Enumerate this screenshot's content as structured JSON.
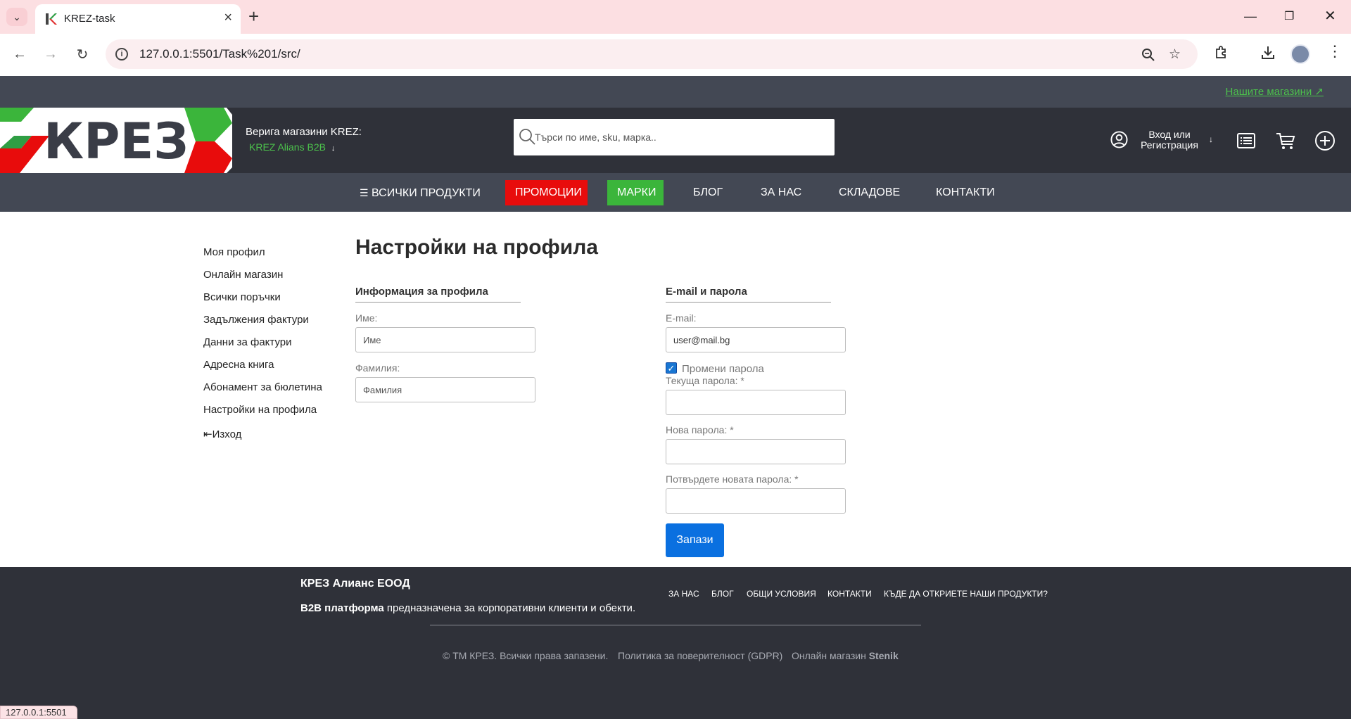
{
  "browser": {
    "tab_title": "KREZ-task",
    "url": "127.0.0.1:5501/Task%201/src/",
    "status_url": "127.0.0.1:5501"
  },
  "site": {
    "shops_link": "Нашите магазини",
    "chain_title": "Верига магазини KREZ:",
    "chain_sub": "KREZ Alians B2B",
    "logo_text": "КРЕЗ",
    "search_placeholder": "Търси по име, sku, марка..",
    "login_line1": "Вход или",
    "login_line2": "Регистрация"
  },
  "nav": {
    "all_products": "ВСИЧКИ ПРОДУКТИ",
    "promotions": "ПРОМОЦИИ",
    "brands": "МАРКИ",
    "blog": "БЛОГ",
    "about": "ЗА НАС",
    "warehouses": "СКЛАДОВЕ",
    "contacts": "КОНТАКТИ"
  },
  "sidebar": {
    "items": [
      "Моя профил",
      "Онлайн магазин",
      "Всички поръчки",
      "Задължения фактури",
      "Данни за фактури",
      "Адресна книга",
      "Абонамент за бюлетина",
      "Настройки на профила"
    ],
    "logout": "Изход"
  },
  "profile": {
    "page_title": "Настройки на профила",
    "info_section": "Информация за профила",
    "first_name_label": "Име:",
    "first_name_placeholder": "Име",
    "last_name_label": "Фамилия:",
    "last_name_placeholder": "Фамилия",
    "email_section": "E-mail и парола",
    "email_label": "E-mail:",
    "email_value": "user@mail.bg",
    "change_password_label": "Промени парола",
    "change_password_checked": true,
    "current_password_label": "Текуща парола: *",
    "new_password_label": "Нова парола: *",
    "confirm_password_label": "Потвърдете новата парола: *",
    "save_label": "Запази"
  },
  "footer": {
    "company": "КРЕЗ Алианс ЕООД",
    "desc_bold": "B2B платформа",
    "desc_rest": " предназначена за корпоративни клиенти и обекти.",
    "links": [
      "ЗА НАС",
      "БЛОГ",
      "ОБЩИ УСЛОВИЯ",
      "КОНТАКТИ",
      "КЪДЕ ДА ОТКРИЕТЕ НАШИ ПРОДУКТИ?"
    ],
    "copyright": "© ТМ КРЕЗ. Всички права запазени.",
    "privacy": "Политика за поверителност (GDPR)",
    "online_shop": "Онлайн магазин",
    "online_shop_brand": "Stenik"
  },
  "colors": {
    "accent_green": "#4cc24c",
    "promo_red": "#e80c0c",
    "brands_green": "#3bb53b",
    "save_blue": "#0a70e0",
    "dark_bg": "#2f3139",
    "strip_bg": "#434854"
  }
}
